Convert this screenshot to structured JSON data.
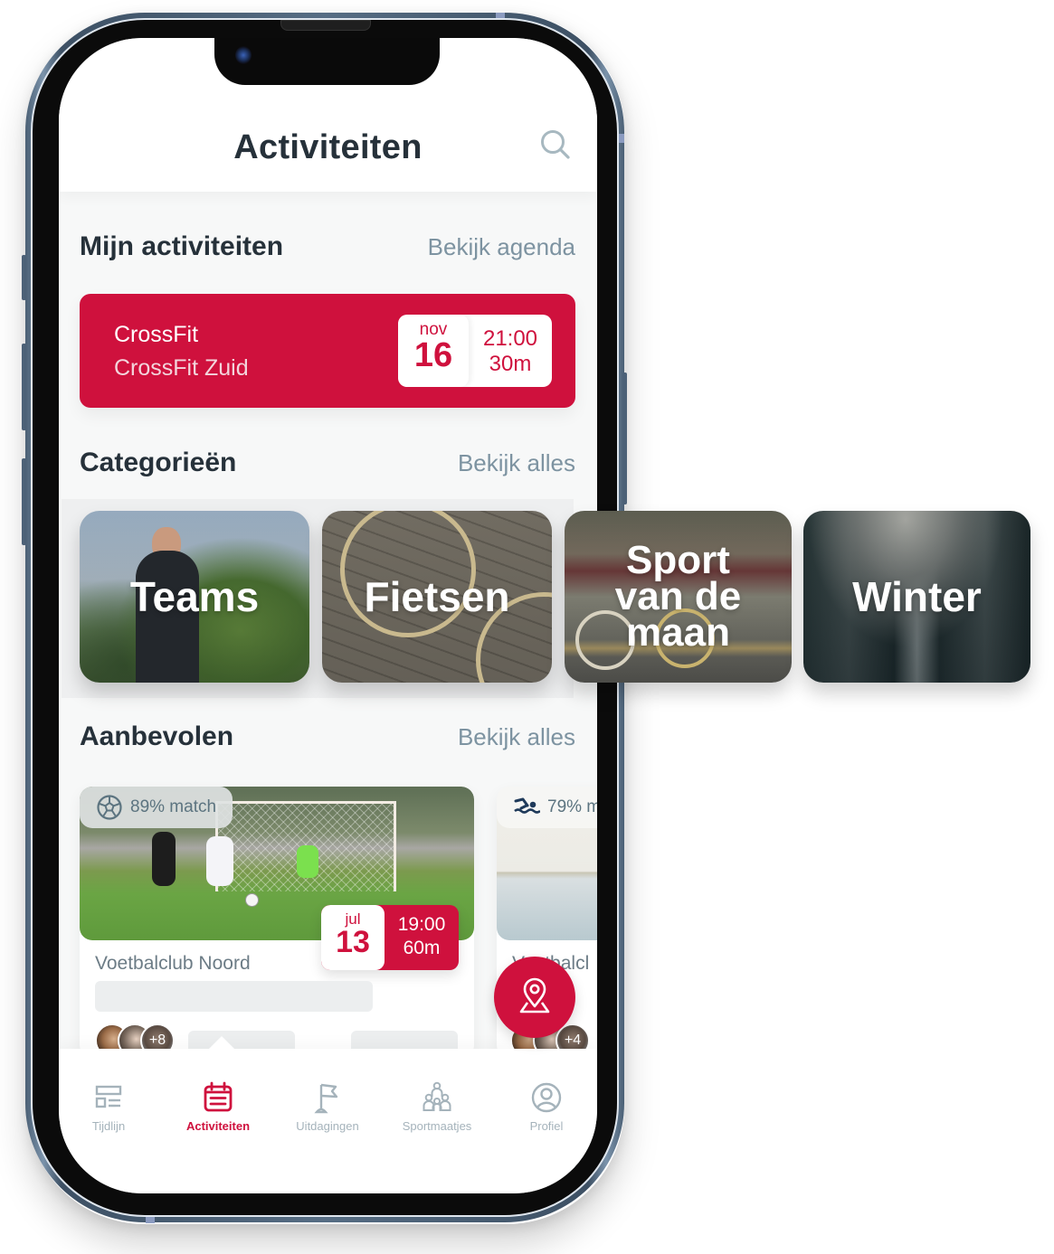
{
  "header": {
    "title": "Activiteiten",
    "search_icon": "search-icon"
  },
  "my_activities": {
    "title": "Mijn activiteiten",
    "link": "Bekijk agenda",
    "items": [
      {
        "name": "CrossFit",
        "location": "CrossFit Zuid",
        "month": "nov",
        "day": "16",
        "time": "21:00",
        "duration": "30m"
      }
    ]
  },
  "categories": {
    "title": "Categorieën",
    "link": "Bekijk alles",
    "items": [
      {
        "label": "Teams"
      },
      {
        "label": "Fietsen"
      },
      {
        "label": "Sport van de maan"
      },
      {
        "label": "Winter"
      }
    ]
  },
  "recommended": {
    "title": "Aanbevolen",
    "link": "Bekijk alles",
    "items": [
      {
        "match": "89% match",
        "sport_icon": "soccer-ball-icon",
        "month": "jul",
        "day": "13",
        "time": "19:00",
        "duration": "60m",
        "name": "Voetbalclub Noord",
        "extra_participants": "+8"
      },
      {
        "match": "79% m",
        "sport_icon": "swimming-icon",
        "name": "Voetbalcl",
        "extra_participants": "+4"
      }
    ]
  },
  "fab": {
    "icon": "map-pin-icon"
  },
  "tab_bar": {
    "active": "Activiteiten",
    "tabs": [
      {
        "label": "Tijdlijn",
        "icon": "timeline-icon"
      },
      {
        "label": "Activiteiten",
        "icon": "calendar-icon"
      },
      {
        "label": "Uitdagingen",
        "icon": "flag-icon"
      },
      {
        "label": "Sportmaatjes",
        "icon": "buddies-icon"
      },
      {
        "label": "Profiel",
        "icon": "profile-icon"
      }
    ]
  },
  "colors": {
    "brand": "#cf113d",
    "text_dark": "#26313a",
    "text_muted": "#7d93a1",
    "tab_inactive": "#a5b3bb"
  }
}
